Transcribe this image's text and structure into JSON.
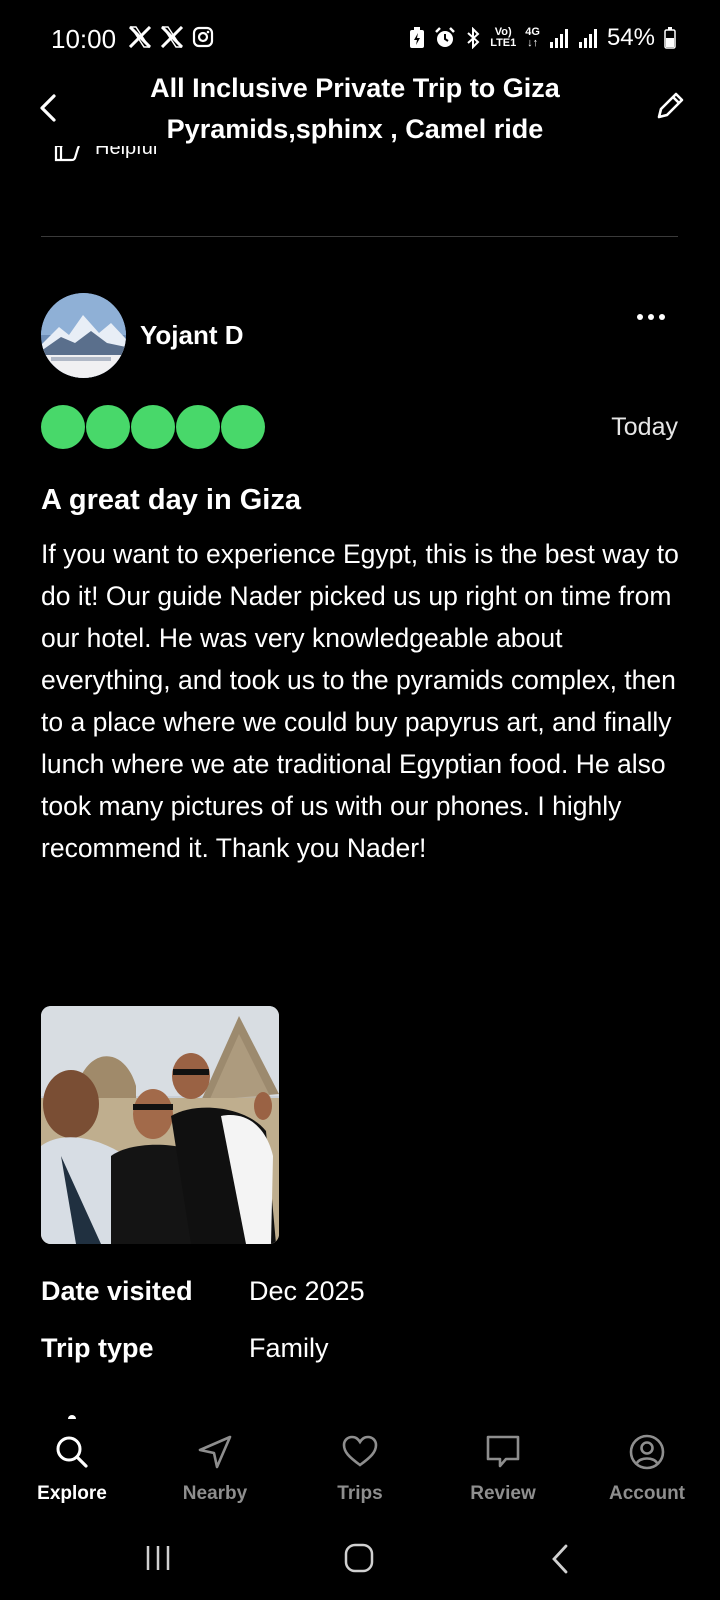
{
  "status_bar": {
    "time": "10:00",
    "left_icons": [
      "x-icon",
      "x-icon",
      "instagram-icon"
    ],
    "right_icons": [
      "battery-saver-icon",
      "alarm-icon",
      "bluetooth-icon",
      "volte-icon",
      "4g-icon",
      "signal-icon",
      "signal-icon"
    ],
    "network_top": "Vo)",
    "network_bottom": "LTE1",
    "network_type": "4G",
    "battery": "54%"
  },
  "header": {
    "title": "All Inclusive Private Trip to Giza Pyramids,sphinx , Camel ride",
    "back_icon": "chevron-left-icon",
    "edit_icon": "pencil-icon"
  },
  "helpful": {
    "label": "Helpful",
    "icon": "thumbs-up-icon"
  },
  "review": {
    "reviewer_name": "Yojant D",
    "rating": 5,
    "date": "Today",
    "title": "A great day in Giza",
    "body": "If you want to experience Egypt, this is the best way to do it! Our guide Nader picked us up right on time from our hotel. He was very knowledgeable about everything, and took us to the pyramids complex, then to a place where we could buy papyrus art, and finally lunch where we ate traditional Egyptian food. He also took many pictures of us with our phones. I highly recommend it. Thank you Nader!",
    "details": [
      {
        "label": "Date visited",
        "value": "Dec 2025"
      },
      {
        "label": "Trip type",
        "value": "Family"
      }
    ]
  },
  "bottom_nav": {
    "items": [
      {
        "label": "Explore",
        "icon": "search-icon",
        "active": true
      },
      {
        "label": "Nearby",
        "icon": "navigation-arrow-icon",
        "active": false
      },
      {
        "label": "Trips",
        "icon": "heart-icon",
        "active": false
      },
      {
        "label": "Review",
        "icon": "speech-bubble-icon",
        "active": false
      },
      {
        "label": "Account",
        "icon": "user-circle-icon",
        "active": false
      }
    ]
  },
  "colors": {
    "background": "#000000",
    "rating": "#48d86a",
    "nav_inactive": "#8e8e8e"
  }
}
